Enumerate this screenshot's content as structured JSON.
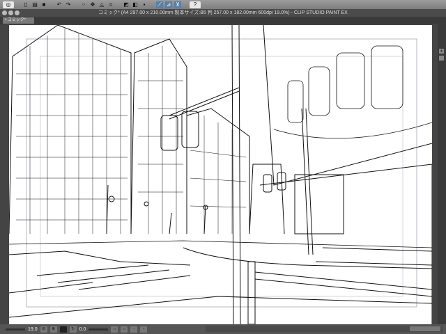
{
  "toolbar": {
    "items": [
      {
        "name": "menu-show-button",
        "icon": "eye-icon",
        "glyph": "◎"
      },
      {
        "name": "new-button",
        "icon": "new-file-icon",
        "glyph": "▯"
      },
      {
        "name": "open-button",
        "icon": "open-folder-icon",
        "glyph": "▤"
      },
      {
        "name": "save-button",
        "icon": "save-icon",
        "glyph": "■"
      },
      {
        "name": "undo-button",
        "icon": "undo-icon",
        "glyph": "↶"
      },
      {
        "name": "redo-button",
        "icon": "redo-icon",
        "glyph": "↷"
      },
      {
        "name": "clear-selection-button",
        "icon": "selection-icon",
        "glyph": "⁘"
      },
      {
        "name": "transform-button",
        "icon": "transform-icon",
        "glyph": "✥"
      },
      {
        "name": "fill-button",
        "icon": "fill-icon",
        "glyph": "◬"
      },
      {
        "name": "scale-button",
        "icon": "scale-icon",
        "glyph": "⌗"
      },
      {
        "name": "layer-a-button",
        "icon": "layer-icon",
        "glyph": "◩"
      },
      {
        "name": "layer-b-button",
        "icon": "layer-icon",
        "glyph": "◧"
      },
      {
        "name": "layer-c-button",
        "icon": "layer-icon",
        "glyph": "▪"
      },
      {
        "name": "snap-ruler-button",
        "icon": "snap-ruler-icon",
        "glyph": "⟋"
      },
      {
        "name": "snap-special-button",
        "icon": "snap-special-icon",
        "glyph": "⊿"
      },
      {
        "name": "snap-grid-button",
        "icon": "snap-grid-icon",
        "glyph": "⊻"
      },
      {
        "name": "help-button",
        "icon": "help-icon",
        "glyph": "?"
      }
    ]
  },
  "window": {
    "title": "コミック* (A4 297.00 x 210.00mm 製本サイズ:B5 判 257.00 x 182.00mm 600dpi 19.0%)  - CLIP STUDIO PAINT EX"
  },
  "tab": {
    "label": "コミック*"
  },
  "status": {
    "zoom": "19.0",
    "angle": "0.0"
  },
  "colors": {
    "accent": "#5a7fa8",
    "chrome": "#4b4b4b"
  }
}
